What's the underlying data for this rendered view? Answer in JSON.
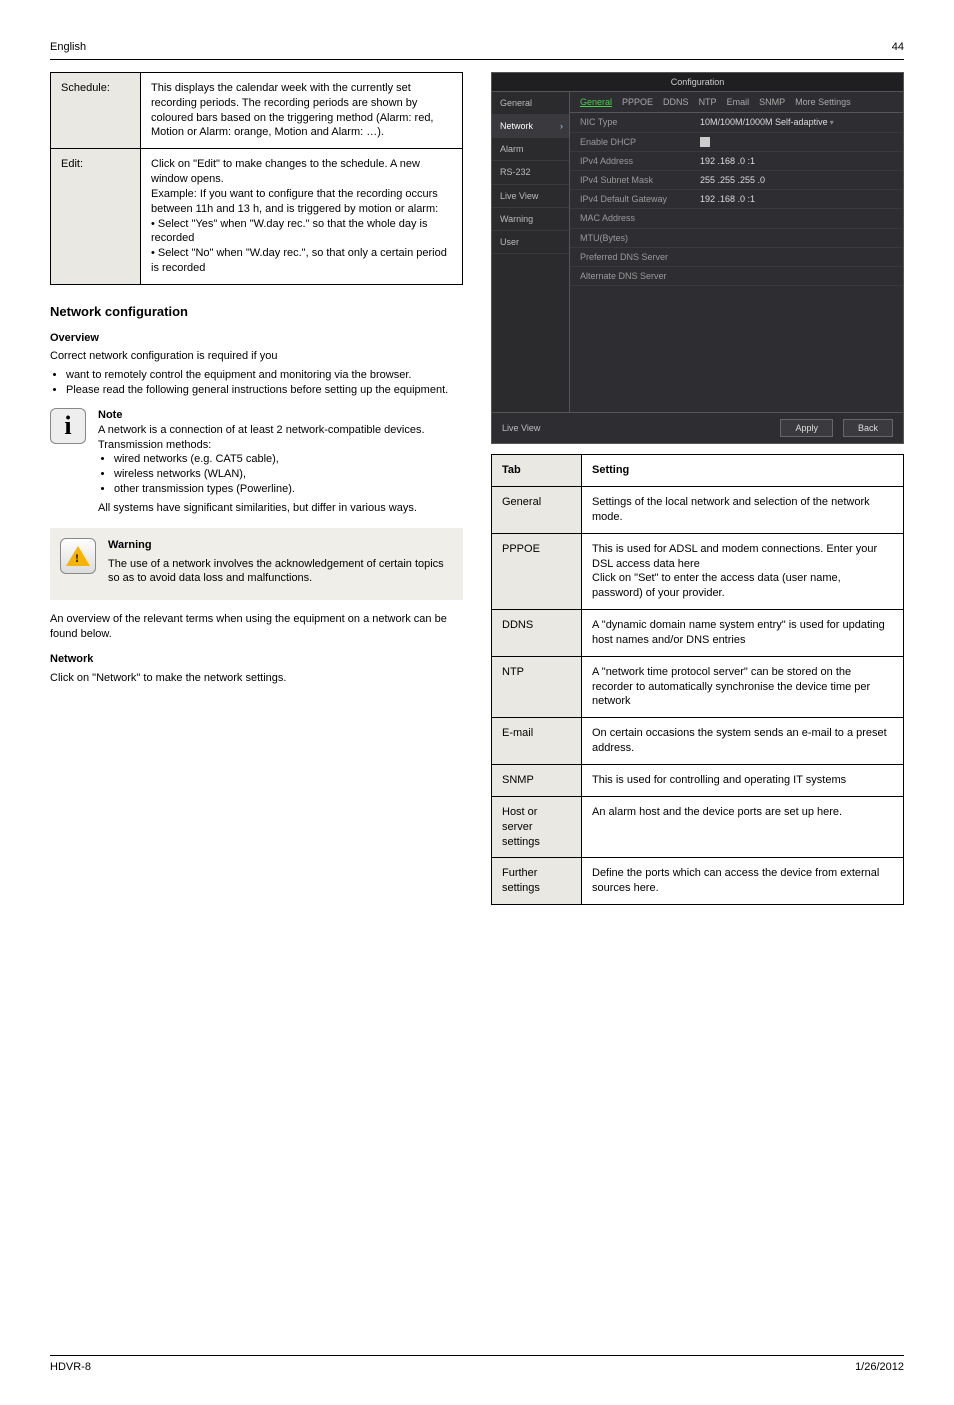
{
  "header": {
    "left": "English",
    "right": "44"
  },
  "footer": {
    "left": "HDVR-8",
    "right": "1/26/2012"
  },
  "left_col": {
    "tbl1": [
      {
        "label": "Schedule:",
        "value": "This displays the calendar week with the currently set recording periods. The recording periods are shown by coloured bars based on the triggering method (Alarm: red, Motion or Alarm: orange, Motion and Alarm: …)."
      },
      {
        "label": "Edit:",
        "value": "Click on \"Edit\" to make changes to the schedule. A new window opens.\nExample: If you want to configure that the recording occurs between 11h and 13 h, and is triggered by motion or alarm:\n• Select \"Yes\" when \"W.day rec.\" so that the whole day is recorded\n• Select \"No\" when \"W.day rec.\", so that only a certain period is recorded"
      }
    ],
    "h1": "Network configuration",
    "h2": "Overview",
    "p1": "Correct network configuration is required if you",
    "bullets": [
      "want to remotely control the equipment and monitoring via the browser.",
      "Please read the following general instructions before setting up the equipment."
    ],
    "note": "Note",
    "note_p": "A network is a connection of at least 2 network-compatible devices.\nTransmission methods:",
    "note_bullets": [
      "wired networks (e.g. CAT5 cable),",
      "wireless networks (WLAN),",
      "other transmission types (Powerline)."
    ],
    "note_p2": "All systems have significant similarities, but differ in various ways.",
    "warn_title": "Warning",
    "warn_body": "The use of a network involves the acknowledgement of certain topics so as to avoid data loss and malfunctions.",
    "glossary_intro": "An overview of the relevant terms when using the equipment on a network can be found below.",
    "h3": "Network",
    "p2": "Click on \"Network\" to make the network settings."
  },
  "shot": {
    "title": "Configuration",
    "side": [
      "General",
      "Network",
      "Alarm",
      "RS-232",
      "Live View",
      "Warning",
      "User"
    ],
    "side_active": 1,
    "tabs": [
      "General",
      "PPPOE",
      "DDNS",
      "NTP",
      "Email",
      "SNMP",
      "More Settings"
    ],
    "tabs_active": 0,
    "rows": [
      {
        "k": "NIC Type",
        "v": "10M/100M/1000M Self-adaptive",
        "dd": true
      },
      {
        "k": "Enable DHCP",
        "chk": true
      },
      {
        "k": "IPv4 Address",
        "v": "192 .168 .0   :1"
      },
      {
        "k": "IPv4 Subnet Mask",
        "v": "255 .255 .255 .0"
      },
      {
        "k": "IPv4 Default Gateway",
        "v": "192 .168 .0   :1"
      },
      {
        "k": "MAC Address",
        "v": ""
      },
      {
        "k": "MTU(Bytes)",
        "v": ""
      },
      {
        "k": "Preferred DNS Server",
        "v": ""
      },
      {
        "k": "Alternate DNS Server",
        "v": ""
      }
    ],
    "foot_left": "Live View",
    "apply": "Apply",
    "back": "Back"
  },
  "right_tbl": [
    {
      "label": "Tab",
      "value": "Setting"
    },
    {
      "label": "General",
      "value": "Settings of the local network and selection of the network mode."
    },
    {
      "label": "PPPOE",
      "value": "This is used for ADSL and modem connections. Enter your DSL access data here\nClick on \"Set\" to enter the access data (user name, password) of your provider."
    },
    {
      "label": "DDNS",
      "value": "A \"dynamic domain name system entry\" is used for updating host names and/or DNS entries"
    },
    {
      "label": "NTP",
      "value": "A \"network time protocol server\" can be stored on the recorder to automatically synchronise the device time per network"
    },
    {
      "label": "E-mail",
      "value": "On certain occasions the system sends an e-mail to a preset address."
    },
    {
      "label": "SNMP",
      "value": "This is used for controlling and operating IT systems"
    },
    {
      "label": "Host or server settings",
      "value": "An alarm host and the device ports are set up here."
    },
    {
      "label": "Further settings",
      "value": "Define the ports which can access the device from external sources here."
    }
  ]
}
